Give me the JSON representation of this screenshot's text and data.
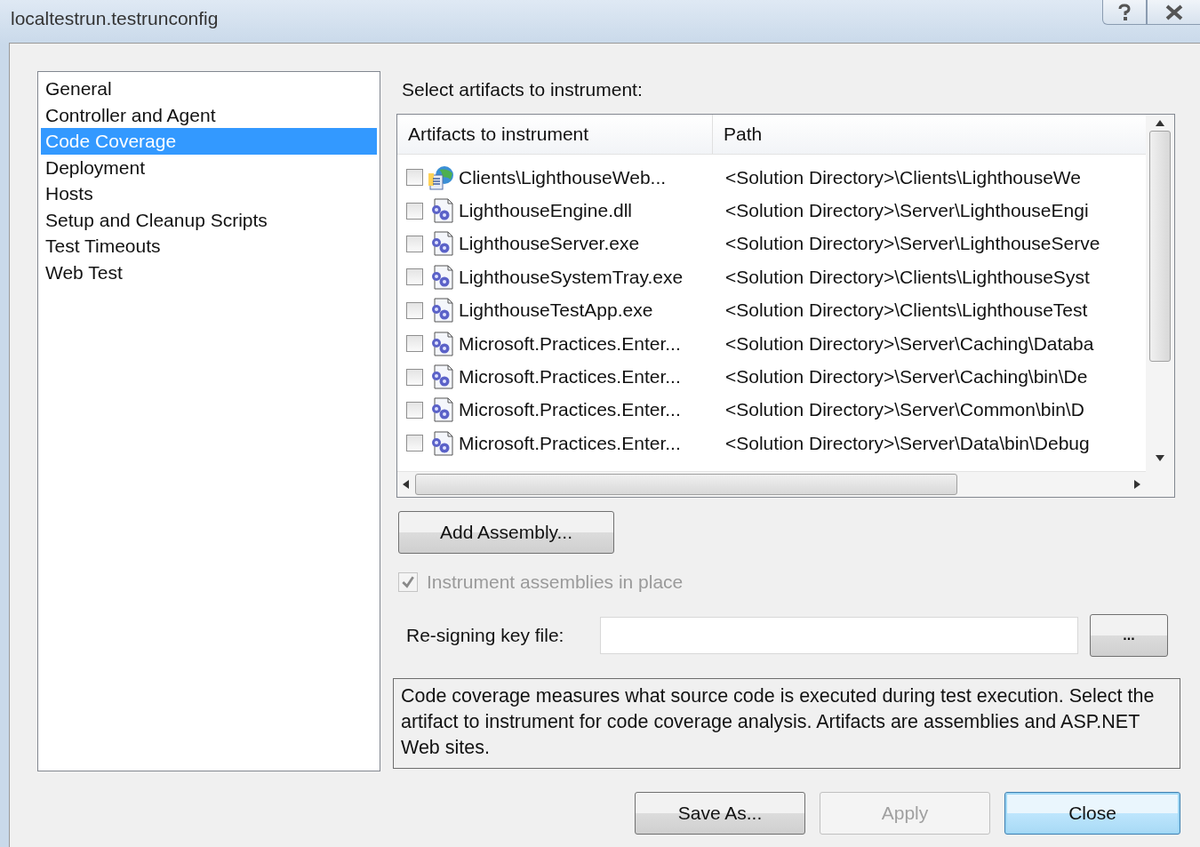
{
  "window": {
    "title": "localtestrun.testrunconfig"
  },
  "sidebar": {
    "items": [
      {
        "label": "General",
        "selected": false
      },
      {
        "label": "Controller and Agent",
        "selected": false
      },
      {
        "label": "Code Coverage",
        "selected": true
      },
      {
        "label": "Deployment",
        "selected": false
      },
      {
        "label": "Hosts",
        "selected": false
      },
      {
        "label": "Setup and Cleanup Scripts",
        "selected": false
      },
      {
        "label": "Test Timeouts",
        "selected": false
      },
      {
        "label": "Web Test",
        "selected": false
      }
    ]
  },
  "artifacts": {
    "label": "Select artifacts to instrument:",
    "columns": [
      "Artifacts to instrument",
      "Path"
    ],
    "rows": [
      {
        "kind": "web",
        "checked": false,
        "name": "Clients\\LighthouseWeb...",
        "path": "<Solution Directory>\\Clients\\LighthouseWe"
      },
      {
        "kind": "assembly",
        "checked": false,
        "name": "LighthouseEngine.dll",
        "path": "<Solution Directory>\\Server\\LighthouseEngi"
      },
      {
        "kind": "assembly",
        "checked": false,
        "name": "LighthouseServer.exe",
        "path": "<Solution Directory>\\Server\\LighthouseServe"
      },
      {
        "kind": "assembly",
        "checked": false,
        "name": "LighthouseSystemTray.exe",
        "path": "<Solution Directory>\\Clients\\LighthouseSyst"
      },
      {
        "kind": "assembly",
        "checked": false,
        "name": "LighthouseTestApp.exe",
        "path": "<Solution Directory>\\Clients\\LighthouseTest"
      },
      {
        "kind": "assembly",
        "checked": false,
        "name": "Microsoft.Practices.Enter...",
        "path": "<Solution Directory>\\Server\\Caching\\Databa"
      },
      {
        "kind": "assembly",
        "checked": false,
        "name": "Microsoft.Practices.Enter...",
        "path": "<Solution Directory>\\Server\\Caching\\bin\\De"
      },
      {
        "kind": "assembly",
        "checked": false,
        "name": "Microsoft.Practices.Enter...",
        "path": "<Solution Directory>\\Server\\Common\\bin\\D"
      },
      {
        "kind": "assembly",
        "checked": false,
        "name": "Microsoft.Practices.Enter...",
        "path": "<Solution Directory>\\Server\\Data\\bin\\Debug"
      }
    ]
  },
  "add_button": "Add Assembly...",
  "instrument_in_place": {
    "label": "Instrument assemblies in place",
    "checked": true,
    "disabled": true
  },
  "resign": {
    "label": "Re-signing key file:",
    "browse": "..."
  },
  "description": "Code coverage measures what source code is executed during test execution. Select the artifact to instrument for code coverage analysis. Artifacts are assemblies and ASP.NET Web sites.",
  "buttons": [
    {
      "label": "Save As...",
      "disabled": false,
      "default": false
    },
    {
      "label": "Apply",
      "disabled": true,
      "default": false
    },
    {
      "label": "Close",
      "disabled": false,
      "default": true
    }
  ]
}
